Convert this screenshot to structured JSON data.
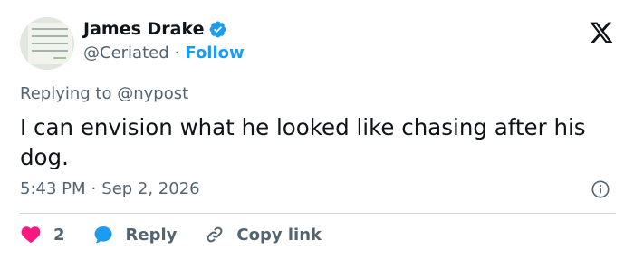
{
  "author": {
    "name": "James Drake",
    "handle": "@Ceriated",
    "separator": "·",
    "follow_label": "Follow",
    "verified": true
  },
  "replying": {
    "prefix": "Replying to",
    "mention": "@nypost"
  },
  "tweet": {
    "text": "I can envision what he looked like chasing after his dog."
  },
  "meta": {
    "time": "5:43 PM",
    "separator": "·",
    "date": "Sep 2, 2026"
  },
  "actions": {
    "like_count": "2",
    "reply_label": "Reply",
    "copy_label": "Copy link"
  },
  "colors": {
    "accent": "#1d9bf0",
    "like": "#f91880",
    "muted": "#536471",
    "text": "#0f1419"
  },
  "icons": [
    "verified-icon",
    "x-logo-icon",
    "info-icon",
    "heart-icon",
    "reply-bubble-icon",
    "link-icon"
  ]
}
